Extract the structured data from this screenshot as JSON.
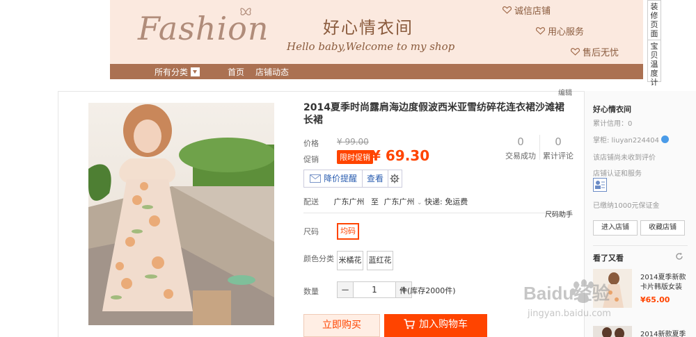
{
  "banner": {
    "logo_text": "Fashion",
    "shop_name": "好心情衣间",
    "welcome": "Hello baby,Welcome to my shop",
    "services": [
      "诚信店铺",
      "用心服务",
      "售后无忧"
    ]
  },
  "nav": {
    "all_categories": "所有分类",
    "home": "首页",
    "shop_news": "店铺动态"
  },
  "vtools": [
    "装修页面",
    "宝贝温度计"
  ],
  "edit_label": "编辑",
  "product": {
    "title": "2014夏季时尚露肩海边度假波西米亚雪纺碎花连衣裙沙滩裙长裙",
    "price_label": "价格",
    "original_price": "¥ 99.00",
    "promo_label": "促销",
    "promo_badge": "限时促销",
    "sale_price": "¥ 69.30",
    "stats": [
      {
        "number": "0",
        "label": "交易成功"
      },
      {
        "number": "0",
        "label": "累计评论"
      }
    ],
    "actions": {
      "price_alert": "降价提醒",
      "view": "查看"
    },
    "shipping": {
      "label": "配送",
      "from": "广东广州",
      "to_word": "至",
      "to": "广东广州",
      "method": "快递: 免运费"
    },
    "size_help": "尺码助手",
    "size_label": "尺码",
    "size_option": "均码",
    "color_label": "颜色分类",
    "colors": [
      "米橘花",
      "蓝红花"
    ],
    "qty_label": "数量",
    "qty_value": "1",
    "qty_minus": "−",
    "qty_plus": "+",
    "stock": "件(库存2000件)",
    "buy_now": "立即购买",
    "add_cart": "加入购物车"
  },
  "seller": {
    "name": "好心情衣间",
    "credit": "累计信用：0",
    "owner": "掌柜: liuyan224404",
    "no_reviews": "该店铺尚未收到评价",
    "cert": "店铺认证和服务",
    "deposit": "已缴纳1000元保证金",
    "enter_shop": "进入店铺",
    "fav_shop": "收藏店铺",
    "also_viewed": "看了又看",
    "rec": [
      {
        "title": "2014夏季新款卡片韩版女装",
        "price": "¥65.00"
      },
      {
        "title": "2014新款夏季",
        "price": ""
      }
    ]
  },
  "watermark": {
    "brand": "Baidu经验",
    "url": "jingyan.baidu.com"
  }
}
